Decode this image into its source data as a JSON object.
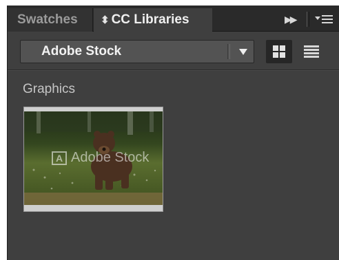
{
  "tabs": [
    {
      "label": "Swatches",
      "active": false
    },
    {
      "label": "CC Libraries",
      "active": true
    }
  ],
  "library_dropdown": {
    "selected": "Adobe Stock"
  },
  "view_toggle": {
    "active": "grid"
  },
  "section": {
    "title": "Graphics"
  },
  "graphics": [
    {
      "watermark": "Adobe Stock",
      "depicts": "brown bear in meadow"
    }
  ],
  "colors": {
    "panel_bg": "#3f3f3f",
    "tabbar_bg": "#2a2a2a",
    "dropdown_bg": "#535353",
    "active_text": "#f0f0f0",
    "inactive_text": "#9a9a9a"
  }
}
